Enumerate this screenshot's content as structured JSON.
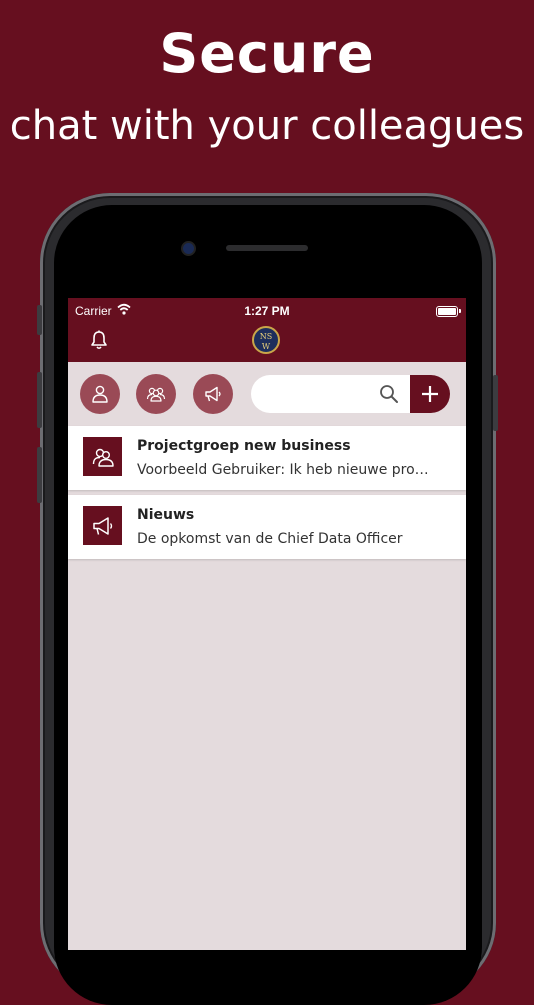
{
  "headline": {
    "title": "Secure",
    "subtitle": "chat with your colleagues"
  },
  "statusbar": {
    "carrier": "Carrier",
    "time": "1:27 PM"
  },
  "navbar": {
    "logo_text_top": "NS",
    "logo_text_bottom": "W"
  },
  "search": {
    "placeholder": ""
  },
  "chats": [
    {
      "title": "Projectgroep new business",
      "preview": "Voorbeeld Gebruiker: Ik heb nieuwe pro…",
      "icon": "group-icon"
    },
    {
      "title": "Nieuws",
      "preview": "De opkomst van de Chief Data Officer",
      "icon": "megaphone-icon"
    }
  ],
  "colors": {
    "brand": "#660f1f",
    "button": "#9a4a56",
    "background": "#e4dbdd"
  }
}
